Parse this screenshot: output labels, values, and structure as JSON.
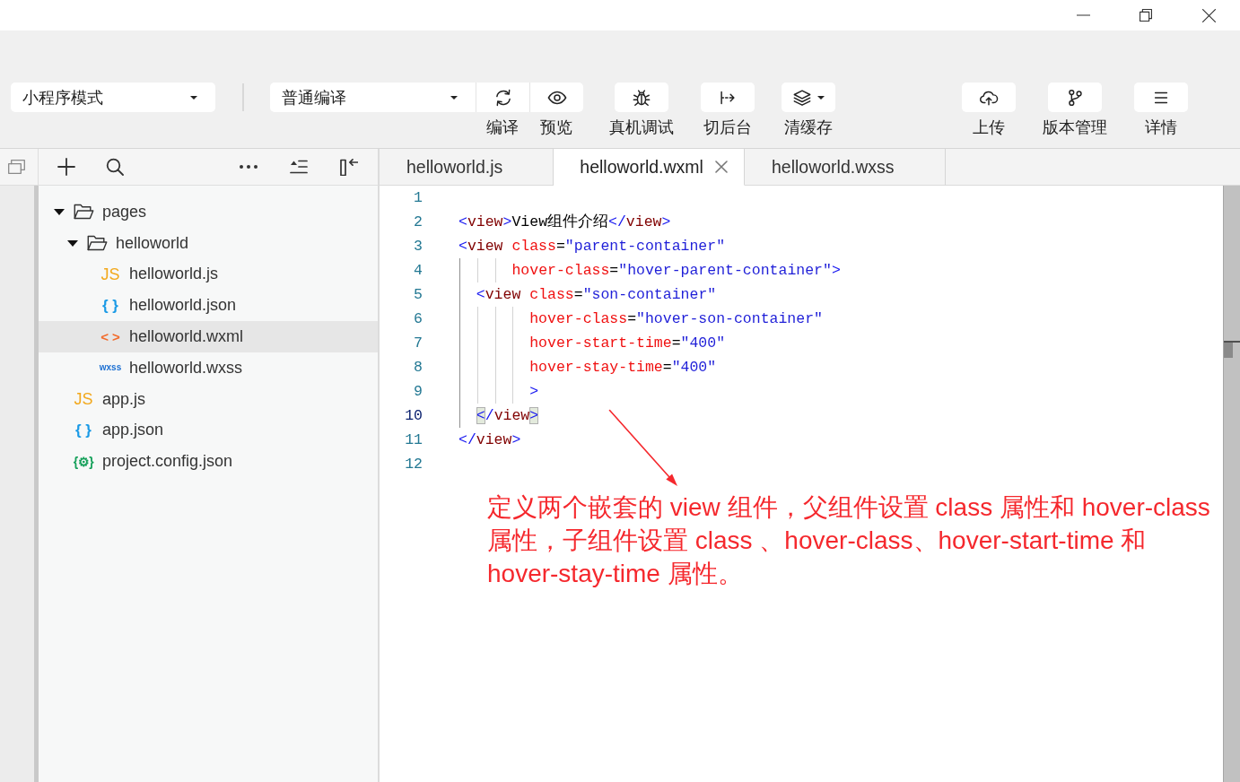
{
  "toolbar": {
    "mode_select": {
      "value": "小程序模式"
    },
    "compile_select": {
      "value": "普通编译"
    },
    "compile_buttons": [
      {
        "kind": "compile",
        "label": "编译"
      },
      {
        "kind": "preview",
        "label": "预览"
      }
    ],
    "tools": [
      {
        "kind": "remote_debug",
        "label": "真机调试"
      },
      {
        "kind": "background",
        "label": "切后台"
      },
      {
        "kind": "clear_cache",
        "label": "清缓存"
      }
    ],
    "right_tools": [
      {
        "kind": "upload",
        "label": "上传"
      },
      {
        "kind": "version",
        "label": "版本管理"
      },
      {
        "kind": "details",
        "label": "详情"
      }
    ]
  },
  "explorer": {
    "tree": [
      {
        "name": "pages",
        "kind": "folder",
        "expanded": true,
        "selected": false,
        "children": [
          {
            "name": "helloworld",
            "kind": "folder",
            "expanded": true,
            "selected": false,
            "children": [
              {
                "name": "helloworld.js",
                "kind": "js",
                "badge": "JS",
                "selected": false
              },
              {
                "name": "helloworld.json",
                "kind": "json",
                "badge": "{ }",
                "selected": false
              },
              {
                "name": "helloworld.wxml",
                "kind": "wxml",
                "badge": "< >",
                "selected": true
              },
              {
                "name": "helloworld.wxss",
                "kind": "wxss",
                "badge": "wxss",
                "selected": false
              }
            ]
          }
        ]
      },
      {
        "name": "app.js",
        "kind": "js",
        "badge": "JS",
        "selected": false
      },
      {
        "name": "app.json",
        "kind": "json",
        "badge": "{ }",
        "selected": false
      },
      {
        "name": "project.config.json",
        "kind": "config",
        "badge": "{⚙}",
        "selected": false
      }
    ]
  },
  "editor": {
    "tabs": [
      {
        "label": "helloworld.js",
        "selected": false
      },
      {
        "label": "helloworld.wxml",
        "selected": true
      },
      {
        "label": "helloworld.wxss",
        "selected": false
      }
    ],
    "lines": [
      {
        "number": "1",
        "current": false
      },
      {
        "number": "2",
        "current": false,
        "tokens": [
          {
            "kind": "punct",
            "text": "<"
          },
          {
            "kind": "tag",
            "text": "view"
          },
          {
            "kind": "punct",
            "text": ">"
          },
          {
            "kind": "text",
            "text": "View组件介绍"
          },
          {
            "kind": "punct",
            "text": "</"
          },
          {
            "kind": "tag",
            "text": "view"
          },
          {
            "kind": "punct",
            "text": ">"
          }
        ]
      },
      {
        "number": "3",
        "current": false,
        "tokens": [
          {
            "kind": "punct",
            "text": "<"
          },
          {
            "kind": "tag",
            "text": "view"
          },
          {
            "kind": "attr",
            "text": " class"
          },
          {
            "kind": "eq",
            "text": "="
          },
          {
            "kind": "string",
            "text": "\"parent-container\""
          }
        ]
      },
      {
        "number": "4",
        "current": false,
        "tokens": [
          {
            "kind": "attr",
            "text": "      hover-class"
          },
          {
            "kind": "eq",
            "text": "="
          },
          {
            "kind": "string",
            "text": "\"hover-parent-container\""
          },
          {
            "kind": "punct",
            "text": ">"
          }
        ]
      },
      {
        "number": "5",
        "current": false,
        "tokens": [
          {
            "kind": "punct",
            "text": "  <"
          },
          {
            "kind": "tag",
            "text": "view"
          },
          {
            "kind": "attr",
            "text": " class"
          },
          {
            "kind": "eq",
            "text": "="
          },
          {
            "kind": "string",
            "text": "\"son-container\""
          }
        ]
      },
      {
        "number": "6",
        "current": false,
        "tokens": [
          {
            "kind": "attr",
            "text": "        hover-class"
          },
          {
            "kind": "eq",
            "text": "="
          },
          {
            "kind": "string",
            "text": "\"hover-son-container\""
          }
        ]
      },
      {
        "number": "7",
        "current": false,
        "tokens": [
          {
            "kind": "attr",
            "text": "        hover-start-time"
          },
          {
            "kind": "eq",
            "text": "="
          },
          {
            "kind": "string",
            "text": "\"400\""
          }
        ]
      },
      {
        "number": "8",
        "current": false,
        "tokens": [
          {
            "kind": "attr",
            "text": "        hover-stay-time"
          },
          {
            "kind": "eq",
            "text": "="
          },
          {
            "kind": "string",
            "text": "\"400\""
          }
        ]
      },
      {
        "number": "9",
        "current": false,
        "tokens": [
          {
            "kind": "punct",
            "text": "        >"
          }
        ]
      },
      {
        "number": "10",
        "current": true,
        "tokens": [
          {
            "kind": "bracket_match",
            "text": "  <"
          },
          {
            "kind": "punct",
            "text": "/"
          },
          {
            "kind": "tag",
            "text": "view"
          },
          {
            "kind": "bracket_match",
            "text": ">"
          }
        ]
      },
      {
        "number": "11",
        "current": false,
        "tokens": [
          {
            "kind": "punct",
            "text": "</"
          },
          {
            "kind": "tag",
            "text": "view"
          },
          {
            "kind": "punct",
            "text": ">"
          }
        ]
      },
      {
        "number": "12",
        "current": false
      }
    ]
  },
  "annotation": {
    "text": "定义两个嵌套的 view 组件，父组件设置 class 属性和 hover-class 属性，子组件设置 class 、hover-class、hover-start-time 和 hover-stay-time 属性。"
  }
}
